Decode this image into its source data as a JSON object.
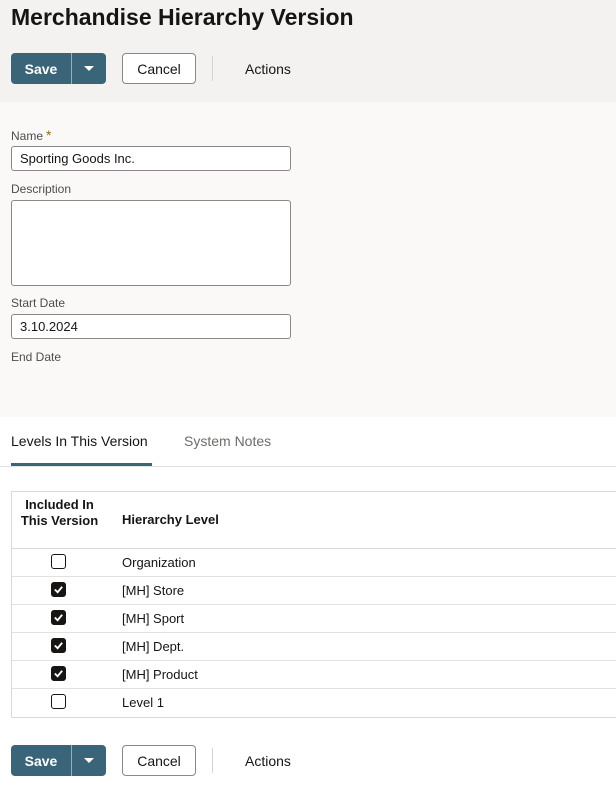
{
  "page": {
    "title": "Merchandise Hierarchy Version"
  },
  "toolbar": {
    "save_label": "Save",
    "cancel_label": "Cancel",
    "actions_label": "Actions"
  },
  "form": {
    "name_label": "Name",
    "required_mark": "*",
    "name_value": "Sporting Goods Inc.",
    "description_label": "Description",
    "description_value": "",
    "start_date_label": "Start Date",
    "start_date_value": "3.10.2024",
    "end_date_label": "End Date"
  },
  "tabs": [
    {
      "label": "Levels In This Version",
      "active": true
    },
    {
      "label": "System Notes",
      "active": false
    }
  ],
  "table": {
    "headers": {
      "included": "Included In This Version",
      "level": "Hierarchy Level"
    },
    "rows": [
      {
        "included": false,
        "level": "Organization"
      },
      {
        "included": true,
        "level": "[MH] Store"
      },
      {
        "included": true,
        "level": "[MH] Sport"
      },
      {
        "included": true,
        "level": "[MH] Dept."
      },
      {
        "included": true,
        "level": "[MH] Product"
      },
      {
        "included": false,
        "level": "Level 1"
      }
    ]
  },
  "colors": {
    "primary": "#3a6478",
    "header_bg": "#f3f2f1",
    "form_bg": "#fbf9f8",
    "required": "#a36a00"
  },
  "icons": {
    "dropdown": "chevron-down-icon",
    "checkbox": "checkmark-icon"
  }
}
